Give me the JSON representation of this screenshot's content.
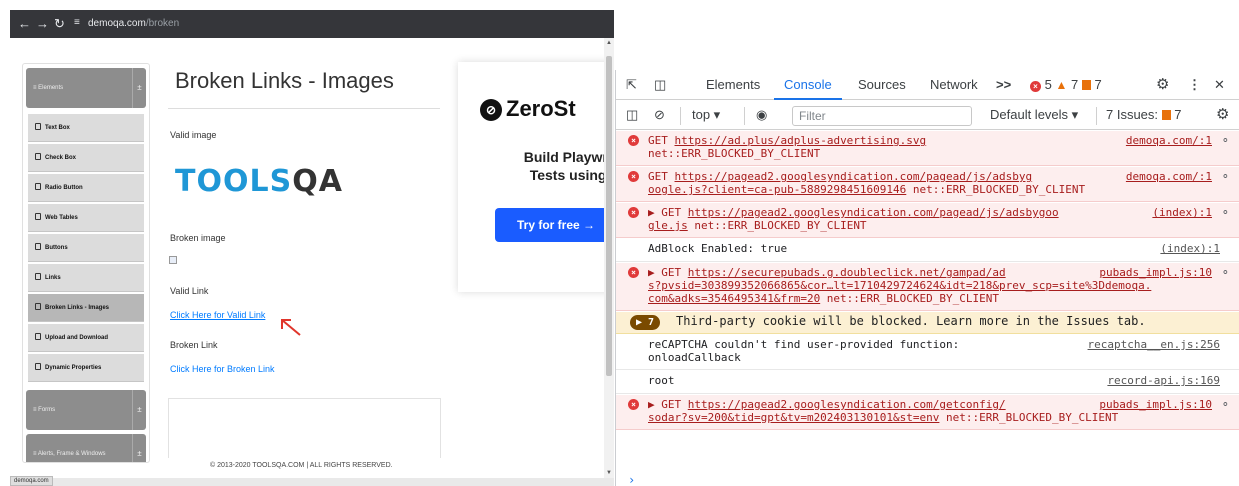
{
  "browser": {
    "url_host": "demoqa.com",
    "url_path": "/broken",
    "status_tip": "demoqa.com"
  },
  "sidebar": {
    "group_elements": "Elements",
    "items": [
      {
        "label": "Text Box"
      },
      {
        "label": "Check Box"
      },
      {
        "label": "Radio Button"
      },
      {
        "label": "Web Tables"
      },
      {
        "label": "Buttons"
      },
      {
        "label": "Links"
      },
      {
        "label": "Broken Links - Images"
      },
      {
        "label": "Upload and Download"
      },
      {
        "label": "Dynamic Properties"
      }
    ],
    "group_forms": "Forms",
    "group_alerts": "Alerts, Frame & Windows"
  },
  "main": {
    "title": "Broken Links - Images",
    "valid_image_label": "Valid image",
    "logo_text": "TOOLS",
    "logo_qa": "QA",
    "broken_image_label": "Broken image",
    "valid_link_label": "Valid Link",
    "valid_link_text": "Click Here for Valid Link",
    "broken_link_label": "Broken Link",
    "broken_link_text": "Click Here for Broken Link",
    "footer": "© 2013-2020 TOOLSQA.COM | ALL RIGHTS RESERVED."
  },
  "ad": {
    "brand": "ZeroSt",
    "headline_1": "Build Playwrig",
    "headline_2": "Tests using ,",
    "cta": "Try for free →"
  },
  "devtools": {
    "tabs": {
      "elements": "Elements",
      "console": "Console",
      "sources": "Sources",
      "network": "Network",
      "more": ">>"
    },
    "counts": {
      "errors": "5",
      "warnings": "7",
      "issues": "7"
    },
    "toolbar": {
      "context": "top ▾",
      "filter_placeholder": "Filter",
      "levels": "Default levels ▾",
      "issues_label": "7 Issues:",
      "issues_count": "7"
    },
    "messages": [
      {
        "line1_pre": "GET ",
        "line1_link": "https://ad.plus/adplus-advertising.svg",
        "line2": "net::ERR_BLOCKED_BY_CLIENT",
        "source": "demoqa.com/:1"
      },
      {
        "line1_pre": "GET ",
        "line1_link": "https://pagead2.googlesyndication.com/pagead/js/adsbyg",
        "line2_link": "oogle.js?client=ca-pub-5889298451609146",
        "line2_post": " net::ERR_BLOCKED_BY_CLIENT",
        "source": "demoqa.com/:1"
      },
      {
        "line1_pre": "▶ GET ",
        "line1_link": "https://pagead2.googlesyndication.com/pagead/js/adsbygoo",
        "line2_link": "gle.js",
        "line2_post": " net::ERR_BLOCKED_BY_CLIENT",
        "source": "(index):1"
      },
      {
        "text": "AdBlock Enabled: true",
        "source": "(index):1"
      },
      {
        "line1_pre": "▶ GET ",
        "line1_link": "https://securepubads.g.doubleclick.net/gampad/ad",
        "line2_link": "s?pvsid=303899352066865&cor…lt=1710429724624&idt=218&prev_scp=site%3Ddemoqa.",
        "line3_link": "com&adks=3546495341&frm=20",
        "line3_post": " net::ERR_BLOCKED_BY_CLIENT",
        "source": "pubads_impl.js:10"
      },
      {
        "badge": "▶ 7",
        "text": "Third-party cookie will be blocked. Learn more in the Issues tab."
      },
      {
        "line1": "reCAPTCHA couldn't find user-provided function:",
        "line2": "onloadCallback",
        "source": "recaptcha__en.js:256"
      },
      {
        "text": "root",
        "source": "record-api.js:169"
      },
      {
        "line1_pre": "▶ GET ",
        "line1_link": "https://pagead2.googlesyndication.com/getconfig/",
        "line2_link": "sodar?sv=200&tid=gpt&tv=m202403130101&st=env",
        "line2_post": " net::ERR_BLOCKED_BY_CLIENT",
        "source": "pubads_impl.js:10"
      }
    ],
    "prompt": "›"
  }
}
